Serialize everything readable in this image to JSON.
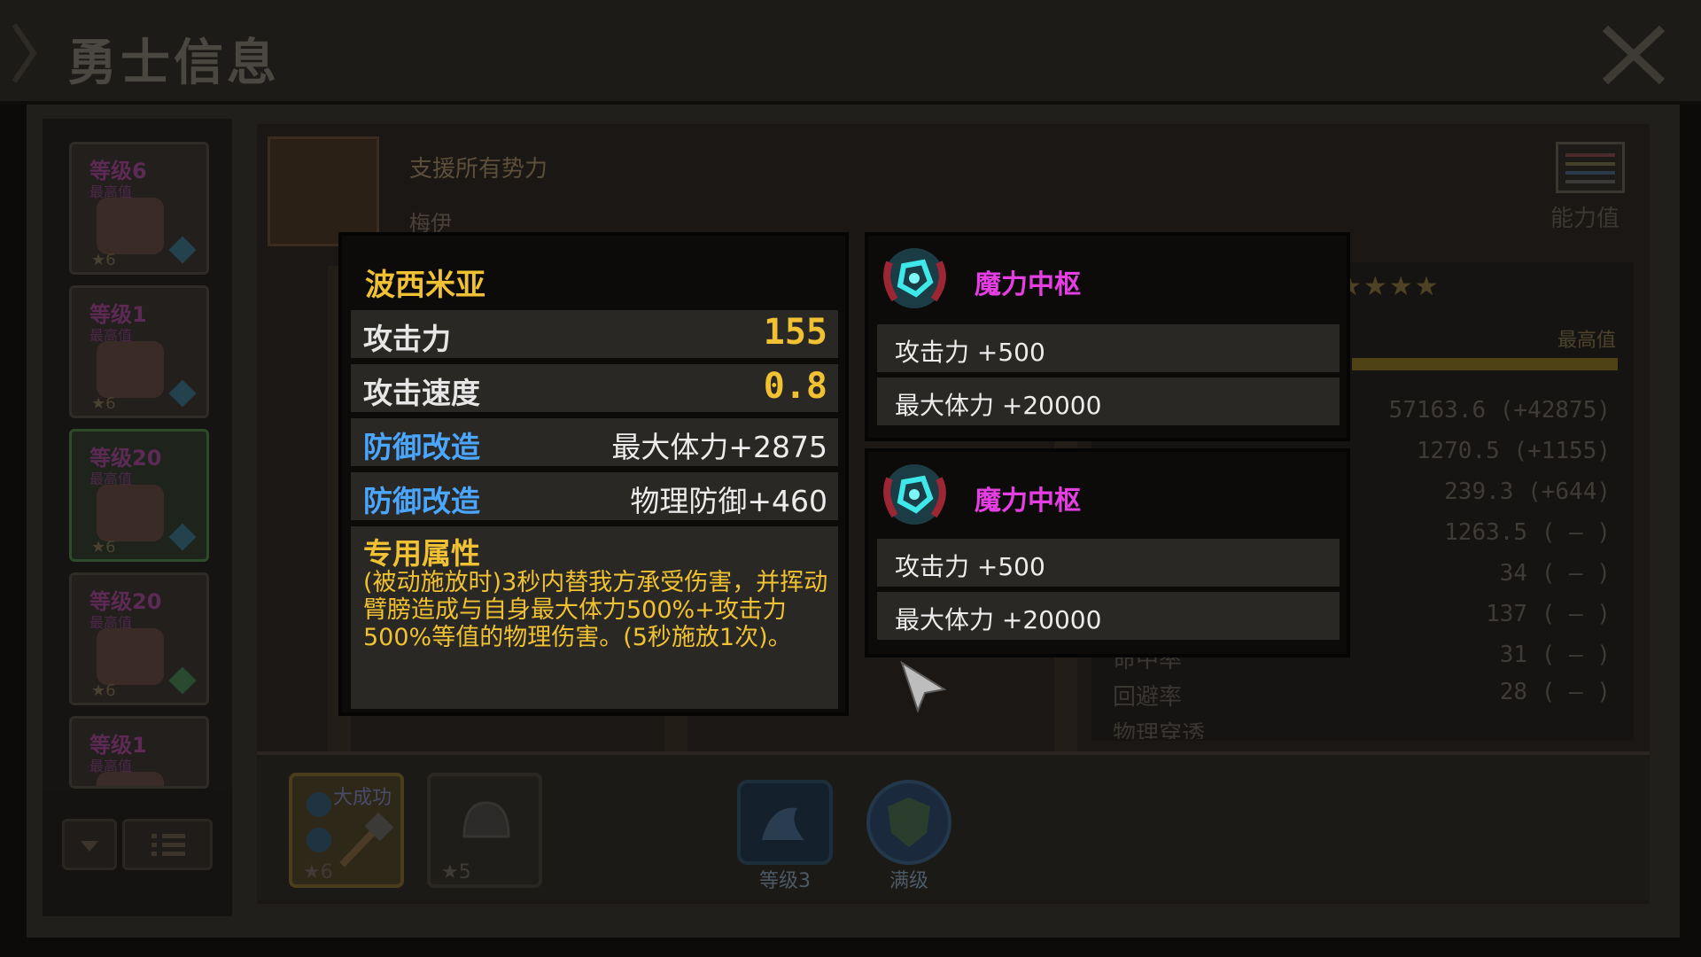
{
  "header": {
    "title": "勇士信息"
  },
  "hero_list": [
    {
      "level": "等级6",
      "max": "最高值",
      "stars": "★6"
    },
    {
      "level": "等级1",
      "max": "最高值",
      "stars": "★6"
    },
    {
      "level": "等级20",
      "max": "最高值",
      "stars": "★6"
    },
    {
      "level": "等级20",
      "max": "最高值",
      "stars": "★6"
    },
    {
      "level": "等级1",
      "max": "最高值",
      "stars": ""
    }
  ],
  "hero_info": {
    "faction": "支援所有势力",
    "name": "梅伊",
    "ability_button": "能力值",
    "max_label": "最高值",
    "stars": "★★★★"
  },
  "stats": [
    {
      "name": "",
      "value": "57163.6 (+42875)"
    },
    {
      "name": "",
      "value": "1270.5 (+1155)"
    },
    {
      "name": "",
      "value": "239.3 (+644)"
    },
    {
      "name": "",
      "value": "1263.5 ( — )"
    },
    {
      "name": "",
      "value": "34 ( — )"
    },
    {
      "name": "",
      "value": "137 ( — )"
    },
    {
      "name": "命中率",
      "value": "31 ( — )"
    },
    {
      "name": "回避率",
      "value": "28 ( — )"
    },
    {
      "name": "物理穿透",
      "value": ""
    }
  ],
  "equipment": [
    {
      "label": "大成功",
      "stars": "★6"
    },
    {
      "label": "",
      "stars": "★5"
    }
  ],
  "skills": [
    {
      "caption": "等级3"
    },
    {
      "caption": "满级"
    }
  ],
  "item_tooltip": {
    "name": "波西米亚",
    "rows": [
      {
        "key": "攻击力",
        "value": "155"
      },
      {
        "key": "攻击速度",
        "value": "0.8"
      },
      {
        "key": "防御改造",
        "value": "最大体力+2875"
      },
      {
        "key": "防御改造",
        "value": "物理防御+460"
      }
    ],
    "special_title": "专用属性",
    "special_desc": "(被动施放时)3秒内替我方承受伤害，并挥动臂膀造成与自身最大体力500%+攻击力500%等值的物理伤害。(5秒施放1次)。"
  },
  "gem_tooltips": [
    {
      "icon": "magic-core-gem-icon",
      "name": "魔力中枢",
      "lines": [
        "攻击力 +500",
        "最大体力 +20000"
      ]
    },
    {
      "icon": "magic-core-gem-icon",
      "name": "魔力中枢",
      "lines": [
        "攻击力 +500",
        "最大体力 +20000"
      ]
    }
  ],
  "colors": {
    "gold": "#f0c233",
    "blue_label": "#4aa6ff",
    "magenta": "#e53ee3",
    "panel": "#2a2824"
  }
}
